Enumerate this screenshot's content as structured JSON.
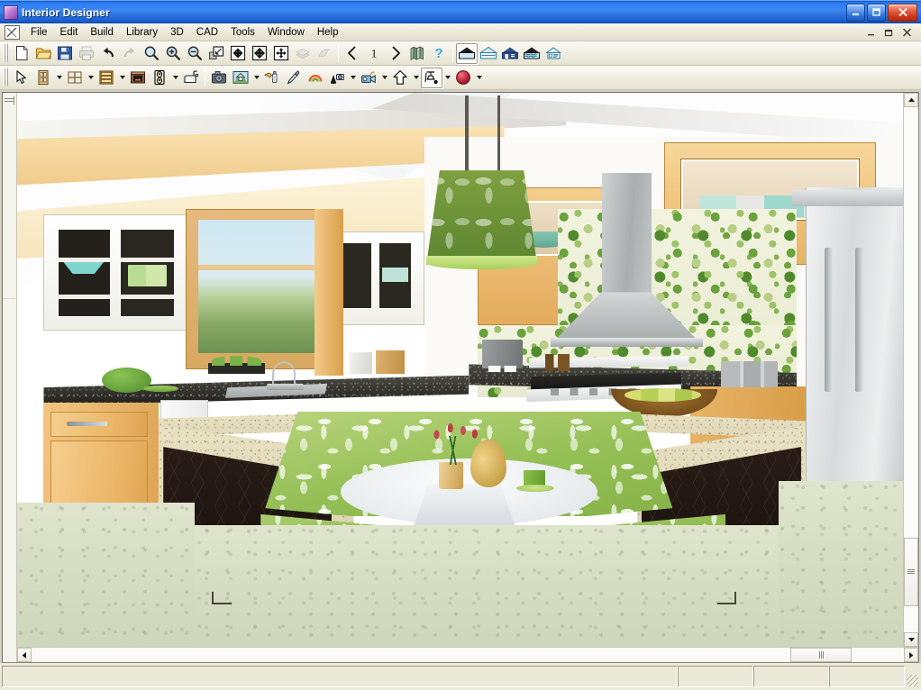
{
  "window": {
    "title": "Interior Designer",
    "app_icon": "app-icon",
    "controls": {
      "minimize": "Minimize",
      "maximize": "Maximize",
      "close": "Close"
    }
  },
  "mdi": {
    "system_icon": "document-system-icon",
    "controls": {
      "minimize": "Minimize Window",
      "restore": "Restore Window",
      "close": "Close Window"
    }
  },
  "menubar": {
    "items": [
      {
        "label": "File"
      },
      {
        "label": "Edit"
      },
      {
        "label": "Build"
      },
      {
        "label": "Library"
      },
      {
        "label": "3D"
      },
      {
        "label": "CAD"
      },
      {
        "label": "Tools"
      },
      {
        "label": "Window"
      },
      {
        "label": "Help"
      }
    ]
  },
  "toolbar_top": {
    "items": [
      {
        "name": "new-plan-button",
        "icon": "new-document-icon",
        "label": "New Plan",
        "state": "normal",
        "caret": false
      },
      {
        "name": "open-plan-button",
        "icon": "open-folder-icon",
        "label": "Open Plan",
        "state": "normal",
        "caret": false
      },
      {
        "name": "save-plan-button",
        "icon": "save-disk-icon",
        "label": "Save Plan",
        "state": "normal",
        "caret": false
      },
      {
        "name": "print-button",
        "icon": "printer-icon",
        "label": "Print",
        "state": "disabled",
        "caret": false
      },
      {
        "name": "undo-button",
        "icon": "undo-arrow-icon",
        "label": "Undo",
        "state": "normal",
        "caret": false
      },
      {
        "name": "redo-button",
        "icon": "redo-arrow-icon",
        "label": "Redo",
        "state": "disabled",
        "caret": false
      },
      {
        "name": "zoom-tool-button",
        "icon": "magnifier-icon",
        "label": "Zoom",
        "state": "normal",
        "caret": false
      },
      {
        "name": "zoom-in-button",
        "icon": "magnifier-plus-icon",
        "label": "Zoom In",
        "state": "normal",
        "caret": false
      },
      {
        "name": "zoom-out-button",
        "icon": "magnifier-minus-icon",
        "label": "Zoom Out",
        "state": "normal",
        "caret": false
      },
      {
        "name": "zoom-window-button",
        "icon": "zoom-window-icon",
        "label": "Zoom Window",
        "state": "normal",
        "caret": false
      },
      {
        "name": "fill-window-button",
        "icon": "fill-window-icon",
        "label": "Fill Window",
        "state": "normal",
        "caret": false
      },
      {
        "name": "fill-window-all-button",
        "icon": "fill-window-all-icon",
        "label": "Fill Window Building",
        "state": "normal",
        "caret": false
      },
      {
        "name": "pan-window-button",
        "icon": "pan-arrows-icon",
        "label": "Pan Window",
        "state": "normal",
        "caret": false
      },
      {
        "name": "reference-display-button",
        "icon": "layers-icon",
        "label": "Reference Display",
        "state": "disabled",
        "caret": false
      },
      {
        "name": "color-toggle-button",
        "icon": "color-bird-icon",
        "label": "Color On/Off",
        "state": "disabled",
        "caret": false
      },
      {
        "name": "previous-floor-button",
        "icon": "chevron-left-icon",
        "label": "Down One Floor",
        "state": "normal",
        "caret": false
      },
      {
        "name": "floor-number-button",
        "icon": "floor-number-icon",
        "label": "Floor 1",
        "state": "normal",
        "caret": false
      },
      {
        "name": "next-floor-button",
        "icon": "chevron-right-icon",
        "label": "Up One Floor",
        "state": "normal",
        "caret": false
      },
      {
        "name": "library-browser-button",
        "icon": "library-books-icon",
        "label": "Library Browser",
        "state": "normal",
        "caret": false
      },
      {
        "name": "help-button",
        "icon": "question-mark-icon",
        "label": "Help",
        "state": "normal",
        "caret": false
      }
    ],
    "view_modes": [
      {
        "name": "view-mode-full-camera",
        "icon": "camera-view-icon",
        "label": "Full Camera",
        "state": "pressed"
      },
      {
        "name": "view-mode-perspective",
        "icon": "perspective-icon",
        "label": "Perspective View",
        "state": "normal"
      },
      {
        "name": "view-mode-doll-house",
        "icon": "doll-house-icon",
        "label": "Doll House View",
        "state": "normal"
      },
      {
        "name": "view-mode-framing",
        "icon": "framing-icon",
        "label": "Framing Overview",
        "state": "normal"
      },
      {
        "name": "view-mode-plan",
        "icon": "plan-view-icon",
        "label": "Plan View",
        "state": "normal"
      }
    ]
  },
  "toolbar_second": {
    "items": [
      {
        "name": "select-tool-button",
        "icon": "arrow-pointer-icon",
        "label": "Select Objects",
        "state": "normal",
        "caret": false
      },
      {
        "name": "door-tool-button",
        "icon": "door-icon",
        "label": "Doors",
        "state": "normal",
        "caret": true
      },
      {
        "name": "window-tool-button",
        "icon": "window-icon",
        "label": "Windows",
        "state": "normal",
        "caret": true
      },
      {
        "name": "cabinet-tool-button",
        "icon": "cabinet-icon",
        "label": "Cabinets",
        "state": "normal",
        "caret": true
      },
      {
        "name": "fireplace-tool-button",
        "icon": "fireplace-icon",
        "label": "Fireplace",
        "state": "normal",
        "caret": false
      },
      {
        "name": "electrical-tool-button",
        "icon": "outlet-icon",
        "label": "Electrical",
        "state": "normal",
        "caret": true
      },
      {
        "name": "fixture-tool-button",
        "icon": "sink-fixture-icon",
        "label": "Fixtures",
        "state": "normal",
        "caret": false
      },
      {
        "name": "picture-tool-button",
        "icon": "camera-picture-icon",
        "label": "Pictures",
        "state": "normal",
        "caret": false
      },
      {
        "name": "house-tool-button",
        "icon": "house-photo-icon",
        "label": "House Wizard",
        "state": "normal",
        "caret": true
      },
      {
        "name": "paint-tool-button",
        "icon": "paint-spray-icon",
        "label": "Material Painter",
        "state": "normal",
        "caret": false
      },
      {
        "name": "eyedropper-button",
        "icon": "eyedropper-icon",
        "label": "Material Eyedropper",
        "state": "normal",
        "caret": false
      },
      {
        "name": "material-rainbow-button",
        "icon": "rainbow-icon",
        "label": "Materials",
        "state": "normal",
        "caret": false
      },
      {
        "name": "terrain-tool-button",
        "icon": "terrain-camera-icon",
        "label": "Terrain",
        "state": "normal",
        "caret": true
      },
      {
        "name": "camera-tool-button",
        "icon": "video-camera-icon",
        "label": "Cameras",
        "state": "normal",
        "caret": true
      },
      {
        "name": "up-one-level-button",
        "icon": "up-arrow-icon",
        "label": "Up One Level",
        "state": "normal",
        "caret": true
      },
      {
        "name": "lighting-tool-button",
        "icon": "light-fixture-icon",
        "label": "Lighting",
        "state": "pressed",
        "caret": true
      },
      {
        "name": "color-sphere-button",
        "icon": "color-sphere-icon",
        "label": "Color",
        "state": "normal",
        "caret": true
      }
    ]
  },
  "scrollbars": {
    "vertical": {
      "up": "scroll-up",
      "down": "scroll-down"
    },
    "horizontal": {
      "left": "scroll-left",
      "right": "scroll-right"
    }
  },
  "statusbar": {
    "message": "",
    "panel_2": "",
    "panel_3": "",
    "panel_4": ""
  },
  "scene": {
    "name": "kitchen-3d-render",
    "description": "3D rendered kitchen interior with breakfast nook island",
    "colors": {
      "cabinet_wood": "#e9b263",
      "counter_dark": "#2a2924",
      "counter_light": "#ded6b4",
      "upholstery_green": "#94bf55",
      "backsplash_green": "#6aa23c",
      "island_dark": "#1d1410",
      "floor": "#d4dcbe",
      "stainless": "#c6c9ca"
    },
    "objects": [
      {
        "name": "pendant-light",
        "label": "Green floral drum pendant light"
      },
      {
        "name": "range-hood",
        "label": "Stainless steel chimney range hood"
      },
      {
        "name": "refrigerator",
        "label": "Stainless side-by-side refrigerator"
      },
      {
        "name": "gas-cooktop",
        "label": "Gas cooktop with white control panel"
      },
      {
        "name": "kitchen-sink",
        "label": "Double-basin stainless sink with faucet"
      },
      {
        "name": "fruit-bowl",
        "label": "Wooden bowl with green pears"
      },
      {
        "name": "breakfast-table",
        "label": "Round white breakfast table"
      },
      {
        "name": "tulip-vase",
        "label": "Vase with red tulips"
      },
      {
        "name": "gold-vase",
        "label": "Gold gourd vase"
      },
      {
        "name": "green-mug",
        "label": "Green mug on saucer"
      },
      {
        "name": "green-platter",
        "label": "Green platter on cake stand"
      },
      {
        "name": "banquette-seating",
        "label": "Green floral corner banquette"
      },
      {
        "name": "window-view",
        "label": "Window with landscape view"
      },
      {
        "name": "upper-cabinets",
        "label": "Maple upper cabinets with glass doors"
      },
      {
        "name": "dishwasher",
        "label": "White dishwasher"
      },
      {
        "name": "canisters",
        "label": "Stainless steel canisters"
      },
      {
        "name": "coffee-maker",
        "label": "Coffee maker"
      },
      {
        "name": "skylight",
        "label": "Ceiling skylight"
      }
    ]
  }
}
